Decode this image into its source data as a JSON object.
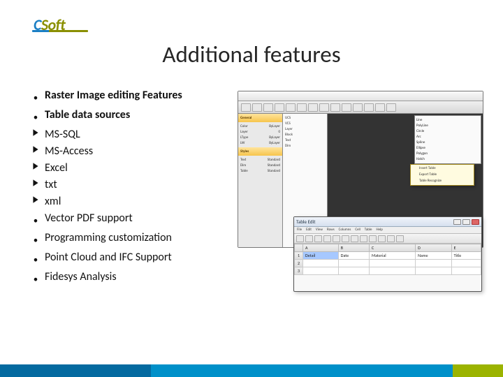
{
  "logo": {
    "c": "C",
    "s": "S",
    "oft": "oft"
  },
  "title": "Additional features",
  "items": [
    {
      "marker": "dot",
      "bold": true,
      "text": "Raster Image editing Features"
    },
    {
      "marker": "dot",
      "bold": true,
      "text": "Table data sources"
    },
    {
      "marker": "arrow",
      "bold": false,
      "text": "MS-SQL"
    },
    {
      "marker": "arrow",
      "bold": false,
      "text": "MS-Access"
    },
    {
      "marker": "arrow",
      "bold": false,
      "text": "Excel"
    },
    {
      "marker": "arrow",
      "bold": false,
      "text": "txt"
    },
    {
      "marker": "arrow",
      "bold": false,
      "text": "xml"
    },
    {
      "marker": "dot",
      "bold": false,
      "text": "Vector PDF support"
    },
    {
      "marker": "dot",
      "bold": false,
      "text": "Programming customization"
    },
    {
      "marker": "dot",
      "bold": false,
      "text": "Point Cloud and IFC Support"
    },
    {
      "marker": "dot",
      "bold": false,
      "text": "Fidesys Analysis"
    }
  ],
  "app1": {
    "sidebar_header": "General",
    "sidebar_rows": [
      {
        "k": "Color",
        "v": "ByLayer"
      },
      {
        "k": "Layer",
        "v": "0"
      },
      {
        "k": "LType",
        "v": "ByLayer"
      },
      {
        "k": "LW",
        "v": "ByLayer"
      }
    ],
    "sidebar_header2": "Styles",
    "sidebar_rows2": [
      {
        "k": "Text",
        "v": "Standard"
      },
      {
        "k": "Dim",
        "v": "Standard"
      },
      {
        "k": "Table",
        "v": "Standard"
      }
    ],
    "list_items": [
      "UCS",
      "VCS",
      "Layer",
      "Block",
      "Text",
      "Dim"
    ],
    "panel_items": [
      "Line",
      "PolyLine",
      "Circle",
      "Arc",
      "Spline",
      "Ellipse",
      "Polygon",
      "Hatch"
    ],
    "submenu_items": [
      "Insert Table",
      "Export Table",
      "Table Recognize"
    ]
  },
  "app2": {
    "title": "Table Edit",
    "menu": [
      "File",
      "Edit",
      "View",
      "Rows",
      "Columns",
      "Cell",
      "Table",
      "Help"
    ],
    "columns": [
      "",
      "A",
      "B",
      "C",
      "D",
      "E"
    ],
    "rows": [
      [
        "1",
        "Detail",
        "Date",
        "Material",
        "Name",
        "Title"
      ],
      [
        "2",
        "",
        "",
        "",
        "",
        ""
      ],
      [
        "3",
        "",
        "",
        "",
        "",
        ""
      ]
    ]
  }
}
